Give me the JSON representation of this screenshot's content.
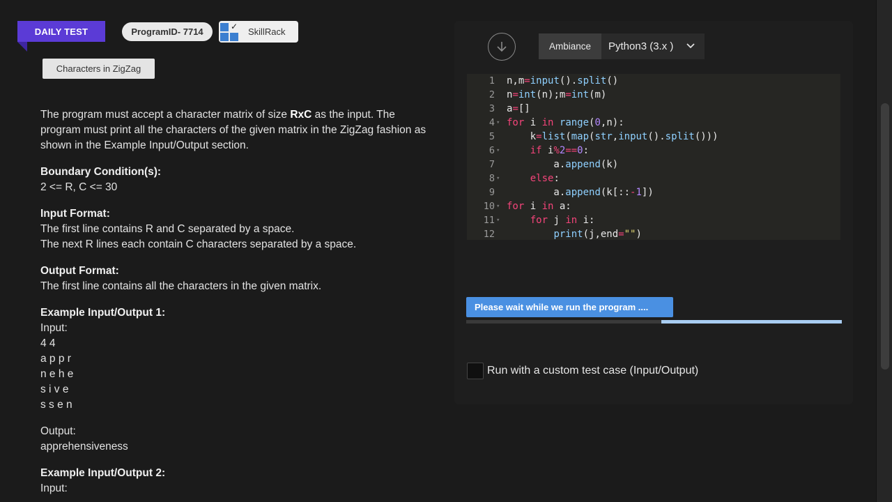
{
  "header": {
    "daily_badge": "DAILY TEST",
    "program_id": "ProgramID- 7714",
    "brand": "SkillRack",
    "problem_title": "Characters in ZigZag"
  },
  "problem": {
    "desc_1": "The program must accept a character matrix of size ",
    "desc_bold": "RxC",
    "desc_2": " as the input. The program must print all the characters of the given matrix in the ZigZag fashion as shown in the Example Input/Output section.",
    "boundary_heading": "Boundary Condition(s):",
    "boundary_text": "2 <= R, C <= 30",
    "input_heading": "Input Format:",
    "input_line1": "The first line contains R and C separated by a space.",
    "input_line2": "The next R lines each contain C characters separated by a space.",
    "output_heading": "Output Format:",
    "output_text": "The first line contains all the characters in the given matrix.",
    "ex1_heading": "Example Input/Output 1:",
    "ex1_input_label": "Input:",
    "ex1_input_lines": [
      "4 4",
      "a p p r",
      "n e h e",
      "s i v e",
      "s s e n"
    ],
    "ex1_output_label": "Output:",
    "ex1_output": "apprehensiveness",
    "ex2_heading": "Example Input/Output 2:",
    "ex2_input_label": "Input:"
  },
  "toolbar": {
    "ambiance": "Ambiance",
    "language": "Python3 (3.x )"
  },
  "editor": {
    "line_numbers": [
      "1",
      "2",
      "3",
      "4",
      "5",
      "6",
      "7",
      "8",
      "9",
      "10",
      "11",
      "12"
    ]
  },
  "run": {
    "status": "Please wait while we run the program ....",
    "progress_percent": 48,
    "custom_label": "Run with a custom test case (Input/Output)"
  },
  "colors": {
    "accent": "#5b3bd6",
    "run_blue": "#4a90e2",
    "keyword": "#f4447a",
    "function": "#8fd0ff"
  }
}
